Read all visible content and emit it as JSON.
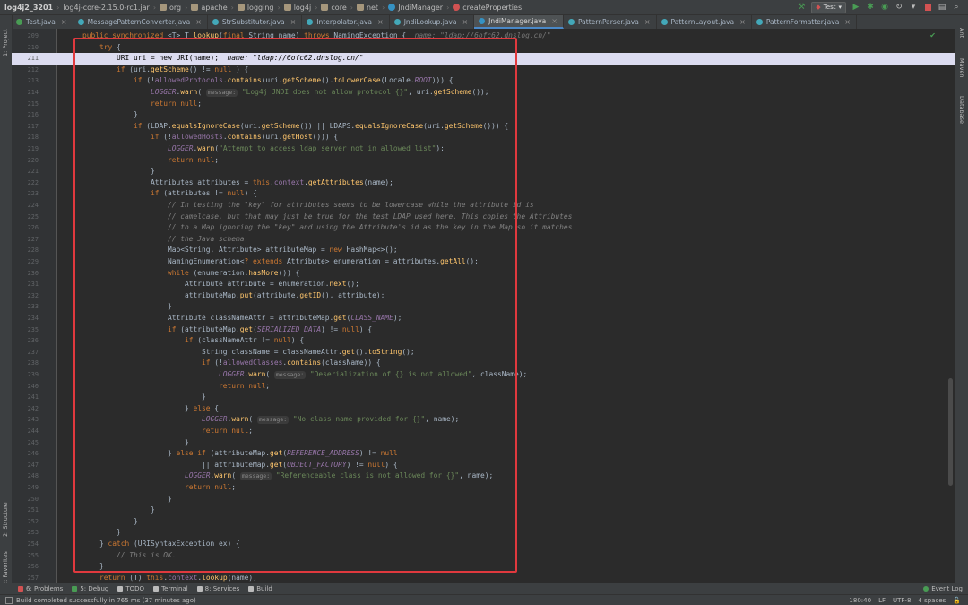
{
  "breadcrumbs": [
    "log4j2_3201",
    "log4j-core-2.15.0-rc1.jar",
    "org",
    "apache",
    "logging",
    "log4j",
    "core",
    "net",
    "JndiManager",
    "createProperties"
  ],
  "run_config": "Test",
  "tabs": [
    {
      "label": "Test.java"
    },
    {
      "label": "MessagePatternConverter.java"
    },
    {
      "label": "StrSubstitutor.java"
    },
    {
      "label": "Interpolator.java"
    },
    {
      "label": "JndiLookup.java"
    },
    {
      "label": "JndiManager.java",
      "active": true
    },
    {
      "label": "PatternParser.java"
    },
    {
      "label": "PatternLayout.java"
    },
    {
      "label": "PatternFormatter.java"
    }
  ],
  "left_strip": [
    "1: Project",
    "2: Structure",
    "2: Favorites"
  ],
  "right_strip": [
    "Ant",
    "Maven",
    "Database"
  ],
  "lines": [
    {
      "n": "209",
      "t": [
        [
          "kw",
          "public synchronized "
        ],
        [
          "",
          "<T> T "
        ],
        [
          "mtd",
          "lookup"
        ],
        [
          "",
          "("
        ],
        [
          "kw",
          "final "
        ],
        [
          "",
          "String name) "
        ],
        [
          "kw",
          "throws "
        ],
        [
          "",
          "NamingException {  "
        ],
        [
          "hint",
          "name: \"ldap://6ofc62.dnslog.cn/\""
        ]
      ]
    },
    {
      "n": "210",
      "t": [
        [
          "",
          "    "
        ],
        [
          "kw",
          "try "
        ],
        [
          "",
          "{"
        ]
      ]
    },
    {
      "n": "211",
      "sel": true,
      "t": [
        [
          "",
          "        URI uri = new URI(name);  "
        ],
        [
          "hint",
          "name: \"ldap://6ofc62.dnslog.cn/\""
        ]
      ]
    },
    {
      "n": "212",
      "t": [
        [
          "",
          "        "
        ],
        [
          "kw",
          "if "
        ],
        [
          "",
          "(uri."
        ],
        [
          "mtd",
          "getScheme"
        ],
        [
          "",
          "() != "
        ],
        [
          "kw",
          "null"
        ],
        [
          "",
          " ) {"
        ]
      ]
    },
    {
      "n": "213",
      "t": [
        [
          "",
          "            "
        ],
        [
          "kw",
          "if "
        ],
        [
          "",
          "(!"
        ],
        [
          "fld",
          "allowedProtocols"
        ],
        [
          "",
          "."
        ],
        [
          "mtd",
          "contains"
        ],
        [
          "",
          "(uri."
        ],
        [
          "mtd",
          "getScheme"
        ],
        [
          "",
          "()."
        ],
        [
          "mtd",
          "toLowerCase"
        ],
        [
          "",
          "(Locale."
        ],
        [
          "fld-i",
          "ROOT"
        ],
        [
          "",
          "))) {"
        ]
      ]
    },
    {
      "n": "214",
      "t": [
        [
          "",
          "                "
        ],
        [
          "fld-i",
          "LOGGER"
        ],
        [
          "",
          "."
        ],
        [
          "mtd",
          "warn"
        ],
        [
          "",
          "( "
        ],
        [
          "pill",
          "message:"
        ],
        [
          "",
          " "
        ],
        [
          "str",
          "\"Log4j JNDI does not allow protocol {}\""
        ],
        [
          "",
          ", uri."
        ],
        [
          "mtd",
          "getScheme"
        ],
        [
          "",
          "());"
        ]
      ]
    },
    {
      "n": "215",
      "t": [
        [
          "",
          "                "
        ],
        [
          "kw",
          "return null"
        ],
        [
          "",
          ";"
        ]
      ]
    },
    {
      "n": "216",
      "t": [
        [
          "",
          "            }"
        ]
      ]
    },
    {
      "n": "217",
      "t": [
        [
          "",
          "            "
        ],
        [
          "kw",
          "if "
        ],
        [
          "",
          "(LDAP."
        ],
        [
          "mtd",
          "equalsIgnoreCase"
        ],
        [
          "",
          "(uri."
        ],
        [
          "mtd",
          "getScheme"
        ],
        [
          "",
          "()) || LDAPS."
        ],
        [
          "mtd",
          "equalsIgnoreCase"
        ],
        [
          "",
          "(uri."
        ],
        [
          "mtd",
          "getScheme"
        ],
        [
          "",
          "())) {"
        ]
      ]
    },
    {
      "n": "218",
      "t": [
        [
          "",
          "                "
        ],
        [
          "kw",
          "if "
        ],
        [
          "",
          "(!"
        ],
        [
          "fld",
          "allowedHosts"
        ],
        [
          "",
          "."
        ],
        [
          "mtd",
          "contains"
        ],
        [
          "",
          "(uri."
        ],
        [
          "mtd",
          "getHost"
        ],
        [
          "",
          "())) {"
        ]
      ]
    },
    {
      "n": "219",
      "t": [
        [
          "",
          "                    "
        ],
        [
          "fld-i",
          "LOGGER"
        ],
        [
          "",
          "."
        ],
        [
          "mtd",
          "warn"
        ],
        [
          "",
          "("
        ],
        [
          "str",
          "\"Attempt to access ldap server not in allowed list\""
        ],
        [
          "",
          ");"
        ]
      ]
    },
    {
      "n": "220",
      "t": [
        [
          "",
          "                    "
        ],
        [
          "kw",
          "return null"
        ],
        [
          "",
          ";"
        ]
      ]
    },
    {
      "n": "221",
      "t": [
        [
          "",
          "                }"
        ]
      ]
    },
    {
      "n": "222",
      "t": [
        [
          "",
          "                Attributes attributes = "
        ],
        [
          "kw",
          "this"
        ],
        [
          "",
          "."
        ],
        [
          "fld",
          "context"
        ],
        [
          "",
          "."
        ],
        [
          "mtd",
          "getAttributes"
        ],
        [
          "",
          "(name);"
        ]
      ]
    },
    {
      "n": "223",
      "t": [
        [
          "",
          "                "
        ],
        [
          "kw",
          "if "
        ],
        [
          "",
          "(attributes != "
        ],
        [
          "kw",
          "null"
        ],
        [
          "",
          ") {"
        ]
      ]
    },
    {
      "n": "224",
      "t": [
        [
          "",
          "                    "
        ],
        [
          "cmt",
          "// In testing the \"key\" for attributes seems to be lowercase while the attribute id is"
        ]
      ]
    },
    {
      "n": "225",
      "t": [
        [
          "",
          "                    "
        ],
        [
          "cmt",
          "// camelcase, but that may just be true for the test LDAP used here. This copies the Attributes"
        ]
      ]
    },
    {
      "n": "226",
      "t": [
        [
          "",
          "                    "
        ],
        [
          "cmt",
          "// to a Map ignoring the \"key\" and using the Attribute's id as the key in the Map so it matches"
        ]
      ]
    },
    {
      "n": "227",
      "t": [
        [
          "",
          "                    "
        ],
        [
          "cmt",
          "// the Java schema."
        ]
      ]
    },
    {
      "n": "228",
      "t": [
        [
          "",
          "                    Map<String, Attribute> attributeMap = "
        ],
        [
          "kw",
          "new "
        ],
        [
          "",
          "HashMap<>();"
        ]
      ]
    },
    {
      "n": "229",
      "t": [
        [
          "",
          "                    NamingEnumeration<"
        ],
        [
          "kw",
          "? extends "
        ],
        [
          "",
          "Attribute> enumeration = attributes."
        ],
        [
          "mtd",
          "getAll"
        ],
        [
          "",
          "();"
        ]
      ]
    },
    {
      "n": "230",
      "t": [
        [
          "",
          "                    "
        ],
        [
          "kw",
          "while "
        ],
        [
          "",
          "(enumeration."
        ],
        [
          "mtd",
          "hasMore"
        ],
        [
          "",
          "()) {"
        ]
      ]
    },
    {
      "n": "231",
      "t": [
        [
          "",
          "                        Attribute attribute = enumeration."
        ],
        [
          "mtd",
          "next"
        ],
        [
          "",
          "();"
        ]
      ]
    },
    {
      "n": "232",
      "t": [
        [
          "",
          "                        attributeMap."
        ],
        [
          "mtd",
          "put"
        ],
        [
          "",
          "(attribute."
        ],
        [
          "mtd",
          "getID"
        ],
        [
          "",
          "(), attribute);"
        ]
      ]
    },
    {
      "n": "233",
      "t": [
        [
          "",
          "                    }"
        ]
      ]
    },
    {
      "n": "234",
      "t": [
        [
          "",
          "                    Attribute classNameAttr = attributeMap."
        ],
        [
          "mtd",
          "get"
        ],
        [
          "",
          "("
        ],
        [
          "fld-i",
          "CLASS_NAME"
        ],
        [
          "",
          ");"
        ]
      ]
    },
    {
      "n": "235",
      "t": [
        [
          "",
          "                    "
        ],
        [
          "kw",
          "if "
        ],
        [
          "",
          "(attributeMap."
        ],
        [
          "mtd",
          "get"
        ],
        [
          "",
          "("
        ],
        [
          "fld-i",
          "SERIALIZED_DATA"
        ],
        [
          "",
          ") != "
        ],
        [
          "kw",
          "null"
        ],
        [
          "",
          ") {"
        ]
      ]
    },
    {
      "n": "236",
      "t": [
        [
          "",
          "                        "
        ],
        [
          "kw",
          "if "
        ],
        [
          "",
          "(classNameAttr != "
        ],
        [
          "kw",
          "null"
        ],
        [
          "",
          ") {"
        ]
      ]
    },
    {
      "n": "237",
      "t": [
        [
          "",
          "                            String className = classNameAttr."
        ],
        [
          "mtd",
          "get"
        ],
        [
          "",
          "()."
        ],
        [
          "mtd",
          "toString"
        ],
        [
          "",
          "();"
        ]
      ]
    },
    {
      "n": "238",
      "t": [
        [
          "",
          "                            "
        ],
        [
          "kw",
          "if "
        ],
        [
          "",
          "(!"
        ],
        [
          "fld",
          "allowedClasses"
        ],
        [
          "",
          "."
        ],
        [
          "mtd",
          "contains"
        ],
        [
          "",
          "(className)) {"
        ]
      ]
    },
    {
      "n": "239",
      "t": [
        [
          "",
          "                                "
        ],
        [
          "fld-i",
          "LOGGER"
        ],
        [
          "",
          "."
        ],
        [
          "mtd",
          "warn"
        ],
        [
          "",
          "( "
        ],
        [
          "pill",
          "message:"
        ],
        [
          "",
          " "
        ],
        [
          "str",
          "\"Deserialization of {} is not allowed\""
        ],
        [
          "",
          ", className);"
        ]
      ]
    },
    {
      "n": "240",
      "t": [
        [
          "",
          "                                "
        ],
        [
          "kw",
          "return null"
        ],
        [
          "",
          ";"
        ]
      ]
    },
    {
      "n": "241",
      "t": [
        [
          "",
          "                            }"
        ]
      ]
    },
    {
      "n": "242",
      "t": [
        [
          "",
          "                        } "
        ],
        [
          "kw",
          "else "
        ],
        [
          "",
          "{"
        ]
      ]
    },
    {
      "n": "243",
      "t": [
        [
          "",
          "                            "
        ],
        [
          "fld-i",
          "LOGGER"
        ],
        [
          "",
          "."
        ],
        [
          "mtd",
          "warn"
        ],
        [
          "",
          "( "
        ],
        [
          "pill",
          "message:"
        ],
        [
          "",
          " "
        ],
        [
          "str",
          "\"No class name provided for {}\""
        ],
        [
          "",
          ", name);"
        ]
      ]
    },
    {
      "n": "244",
      "t": [
        [
          "",
          "                            "
        ],
        [
          "kw",
          "return null"
        ],
        [
          "",
          ";"
        ]
      ]
    },
    {
      "n": "245",
      "t": [
        [
          "",
          "                        }"
        ]
      ]
    },
    {
      "n": "246",
      "t": [
        [
          "",
          "                    } "
        ],
        [
          "kw",
          "else if "
        ],
        [
          "",
          "(attributeMap."
        ],
        [
          "mtd",
          "get"
        ],
        [
          "",
          "("
        ],
        [
          "fld-i",
          "REFERENCE_ADDRESS"
        ],
        [
          "",
          ") != "
        ],
        [
          "kw",
          "null"
        ]
      ]
    },
    {
      "n": "247",
      "t": [
        [
          "",
          "                            || attributeMap."
        ],
        [
          "mtd",
          "get"
        ],
        [
          "",
          "("
        ],
        [
          "fld-i",
          "OBJECT_FACTORY"
        ],
        [
          "",
          ") != "
        ],
        [
          "kw",
          "null"
        ],
        [
          "",
          ") {"
        ]
      ]
    },
    {
      "n": "248",
      "t": [
        [
          "",
          "                        "
        ],
        [
          "fld-i",
          "LOGGER"
        ],
        [
          "",
          "."
        ],
        [
          "mtd",
          "warn"
        ],
        [
          "",
          "( "
        ],
        [
          "pill",
          "message:"
        ],
        [
          "",
          " "
        ],
        [
          "str",
          "\"Referenceable class is not allowed for {}\""
        ],
        [
          "",
          ", name);"
        ]
      ]
    },
    {
      "n": "249",
      "t": [
        [
          "",
          "                        "
        ],
        [
          "kw",
          "return null"
        ],
        [
          "",
          ";"
        ]
      ]
    },
    {
      "n": "250",
      "t": [
        [
          "",
          "                    }"
        ]
      ]
    },
    {
      "n": "251",
      "t": [
        [
          "",
          "                }"
        ]
      ]
    },
    {
      "n": "252",
      "t": [
        [
          "",
          "            }"
        ]
      ]
    },
    {
      "n": "253",
      "t": [
        [
          "",
          "        }"
        ]
      ]
    },
    {
      "n": "254",
      "t": [
        [
          "",
          "    } "
        ],
        [
          "kw",
          "catch "
        ],
        [
          "",
          "(URISyntaxException ex) {"
        ]
      ]
    },
    {
      "n": "255",
      "t": [
        [
          "",
          "        "
        ],
        [
          "cmt",
          "// This is OK."
        ]
      ]
    },
    {
      "n": "256",
      "t": [
        [
          "",
          "    }"
        ]
      ]
    },
    {
      "n": "257",
      "t": [
        [
          "",
          "    "
        ],
        [
          "kw",
          "return "
        ],
        [
          "",
          "(T) "
        ],
        [
          "kw",
          "this"
        ],
        [
          "",
          "."
        ],
        [
          "fld",
          "context"
        ],
        [
          "",
          "."
        ],
        [
          "mtd",
          "lookup"
        ],
        [
          "",
          "(name);"
        ]
      ]
    }
  ],
  "tool_windows": [
    {
      "label": "6: Problems",
      "color": "#d25252"
    },
    {
      "label": "5: Debug",
      "color": "#499c54"
    },
    {
      "label": "TODO",
      "color": "#bbbbbb"
    },
    {
      "label": "Terminal",
      "color": "#bbbbbb"
    },
    {
      "label": "8: Services",
      "color": "#bbbbbb"
    },
    {
      "label": "Build",
      "color": "#bbbbbb"
    }
  ],
  "event_log": "Event Log",
  "status": {
    "message": "Build completed successfully in 765 ms (37 minutes ago)",
    "position": "180:40",
    "line_sep": "LF",
    "encoding": "UTF-8",
    "indent": "4 spaces"
  }
}
